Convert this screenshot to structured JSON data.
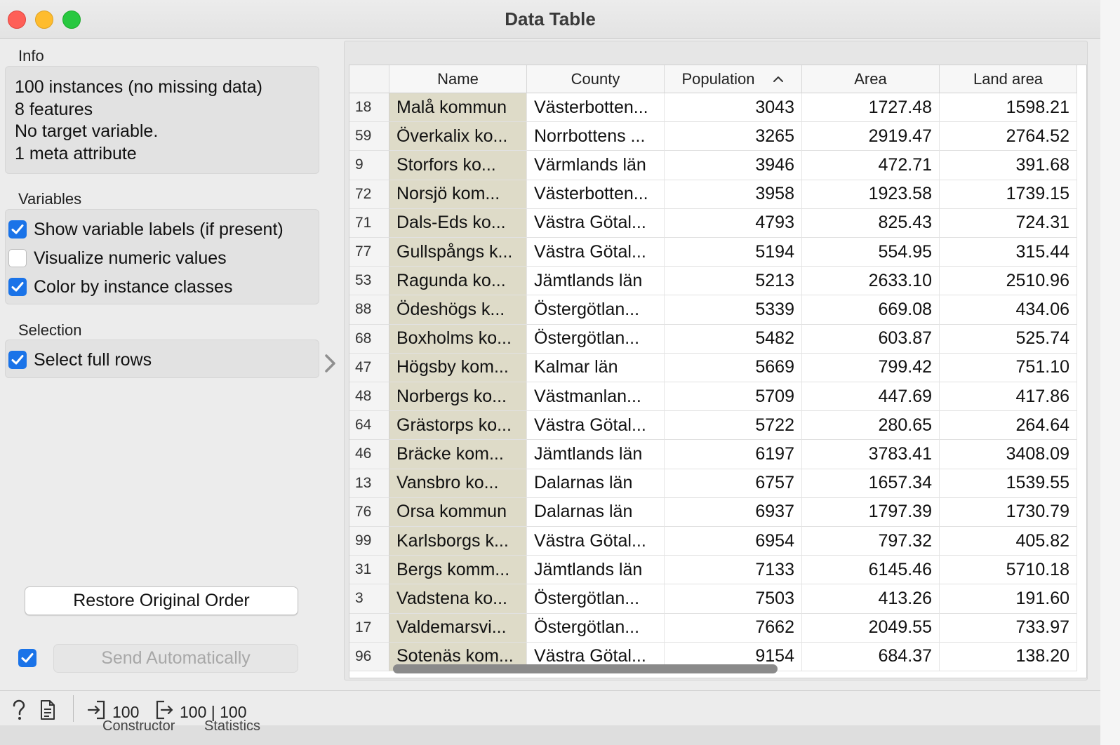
{
  "window": {
    "title": "Data Table"
  },
  "info": {
    "label": "Info",
    "lines": [
      "100 instances (no missing data)",
      "8 features",
      "No target variable.",
      "1 meta attribute"
    ]
  },
  "variables": {
    "label": "Variables",
    "show_labels": {
      "label": "Show variable labels (if present)",
      "checked": true
    },
    "visualize": {
      "label": "Visualize numeric values",
      "checked": false
    },
    "color_by_class": {
      "label": "Color by instance classes",
      "checked": true
    }
  },
  "selection": {
    "label": "Selection",
    "full_rows": {
      "label": "Select full rows",
      "checked": true
    }
  },
  "buttons": {
    "restore": "Restore Original Order",
    "send_auto": "Send Automatically",
    "send_auto_checked": true
  },
  "table": {
    "columns": [
      "Name",
      "County",
      "Population",
      "Area",
      "Land area"
    ],
    "sorted_column": "Population",
    "rows": [
      [
        "18",
        "Malå kommun",
        "Västerbotten...",
        "3043",
        "1727.48",
        "1598.21"
      ],
      [
        "59",
        "Överkalix ko...",
        "Norrbottens ...",
        "3265",
        "2919.47",
        "2764.52"
      ],
      [
        "9",
        "Storfors ko...",
        "Värmlands län",
        "3946",
        "472.71",
        "391.68"
      ],
      [
        "72",
        "Norsjö kom...",
        "Västerbotten...",
        "3958",
        "1923.58",
        "1739.15"
      ],
      [
        "71",
        "Dals-Eds ko...",
        "Västra Götal...",
        "4793",
        "825.43",
        "724.31"
      ],
      [
        "77",
        "Gullspångs k...",
        "Västra Götal...",
        "5194",
        "554.95",
        "315.44"
      ],
      [
        "53",
        "Ragunda ko...",
        "Jämtlands län",
        "5213",
        "2633.10",
        "2510.96"
      ],
      [
        "88",
        "Ödeshögs k...",
        "Östergötlan...",
        "5339",
        "669.08",
        "434.06"
      ],
      [
        "68",
        "Boxholms ko...",
        "Östergötlan...",
        "5482",
        "603.87",
        "525.74"
      ],
      [
        "47",
        "Högsby kom...",
        "Kalmar län",
        "5669",
        "799.42",
        "751.10"
      ],
      [
        "48",
        "Norbergs ko...",
        "Västmanlan...",
        "5709",
        "447.69",
        "417.86"
      ],
      [
        "64",
        "Grästorps ko...",
        "Västra Götal...",
        "5722",
        "280.65",
        "264.64"
      ],
      [
        "46",
        "Bräcke kom...",
        "Jämtlands län",
        "6197",
        "3783.41",
        "3408.09"
      ],
      [
        "13",
        "Vansbro ko...",
        "Dalarnas län",
        "6757",
        "1657.34",
        "1539.55"
      ],
      [
        "76",
        "Orsa kommun",
        "Dalarnas län",
        "6937",
        "1797.39",
        "1730.79"
      ],
      [
        "99",
        "Karlsborgs k...",
        "Västra Götal...",
        "6954",
        "797.32",
        "405.82"
      ],
      [
        "31",
        "Bergs komm...",
        "Jämtlands län",
        "7133",
        "6145.46",
        "5710.18"
      ],
      [
        "3",
        "Vadstena ko...",
        "Östergötlan...",
        "7503",
        "413.26",
        "191.60"
      ],
      [
        "17",
        "Valdemarsvi...",
        "Östergötlan...",
        "7662",
        "2049.55",
        "733.97"
      ],
      [
        "96",
        "Sotenäs kom...",
        "Västra Götal...",
        "9154",
        "684.37",
        "138.20"
      ]
    ]
  },
  "statusbar": {
    "input_count": "100",
    "output_count": "100 | 100"
  },
  "background_tabs": [
    "Constructor",
    "Statistics"
  ],
  "icons": {
    "help": "question-icon",
    "report": "document-icon",
    "input": "input-arrow-icon",
    "output": "output-arrow-icon",
    "collapse": "chevron-right-icon"
  },
  "colors": {
    "accent": "#1a73e8",
    "meta_column": "#dedbc8"
  }
}
